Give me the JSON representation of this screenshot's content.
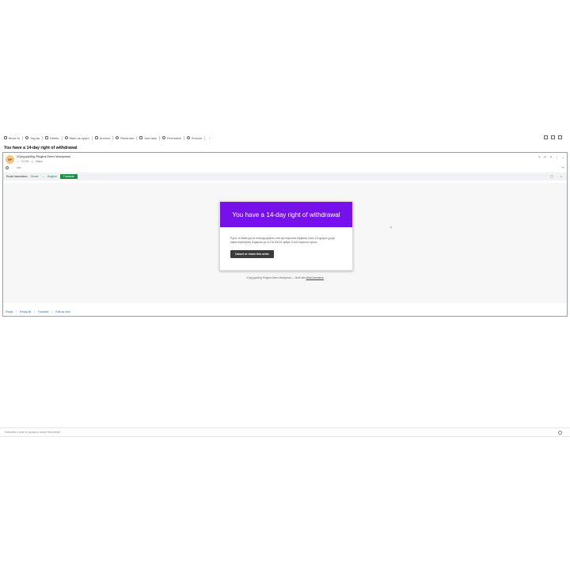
{
  "toolbar": {
    "move_to": "Move to",
    "tag_as": "Tag as",
    "delete": "Delete",
    "mark_spam": "Mark as spam",
    "archive": "Archive",
    "reminder": "Reminder",
    "add_task": "Add task",
    "permalink": "Permalink",
    "snooze": "Snooze",
    "more": "⋮"
  },
  "subject": "You have a 14-day right of withdrawal",
  "message": {
    "avatar_initials": "GP",
    "sender": "//Γρηγοριάδης Plugins Demo Wordpress",
    "meta_size": "2.0 KB",
    "meta_time": "Match",
    "to": "Info"
  },
  "translation": {
    "label": "Email translation",
    "from_lang": "Greek",
    "arrow": "→",
    "to_lang": "English",
    "button": "Translate"
  },
  "email": {
    "heading": "You have a 14-day right of withdrawal",
    "body": "Έχετε το δικαίωμα να υπαναχωρήσετε από την παρούσα σύμβαση εντός 14 ημερών χωρίς καμία αιτιολόγηση σύμφωνα με το ΠΔ 2001/1 άρθρο 3 του παρόντος όρους.",
    "cta": "Cancel or return this order",
    "footer_prefix": "//Γρηγοριάδης Plugins Demo Wordpress — Built with",
    "footer_link": "WooCommerce"
  },
  "reply_bar": {
    "reply": "Reply",
    "reply_all": "Reply All",
    "forward": "Forward",
    "edit_as_new": "Edit as new"
  },
  "share": {
    "placeholder": "Describe a user or group to share this email"
  }
}
